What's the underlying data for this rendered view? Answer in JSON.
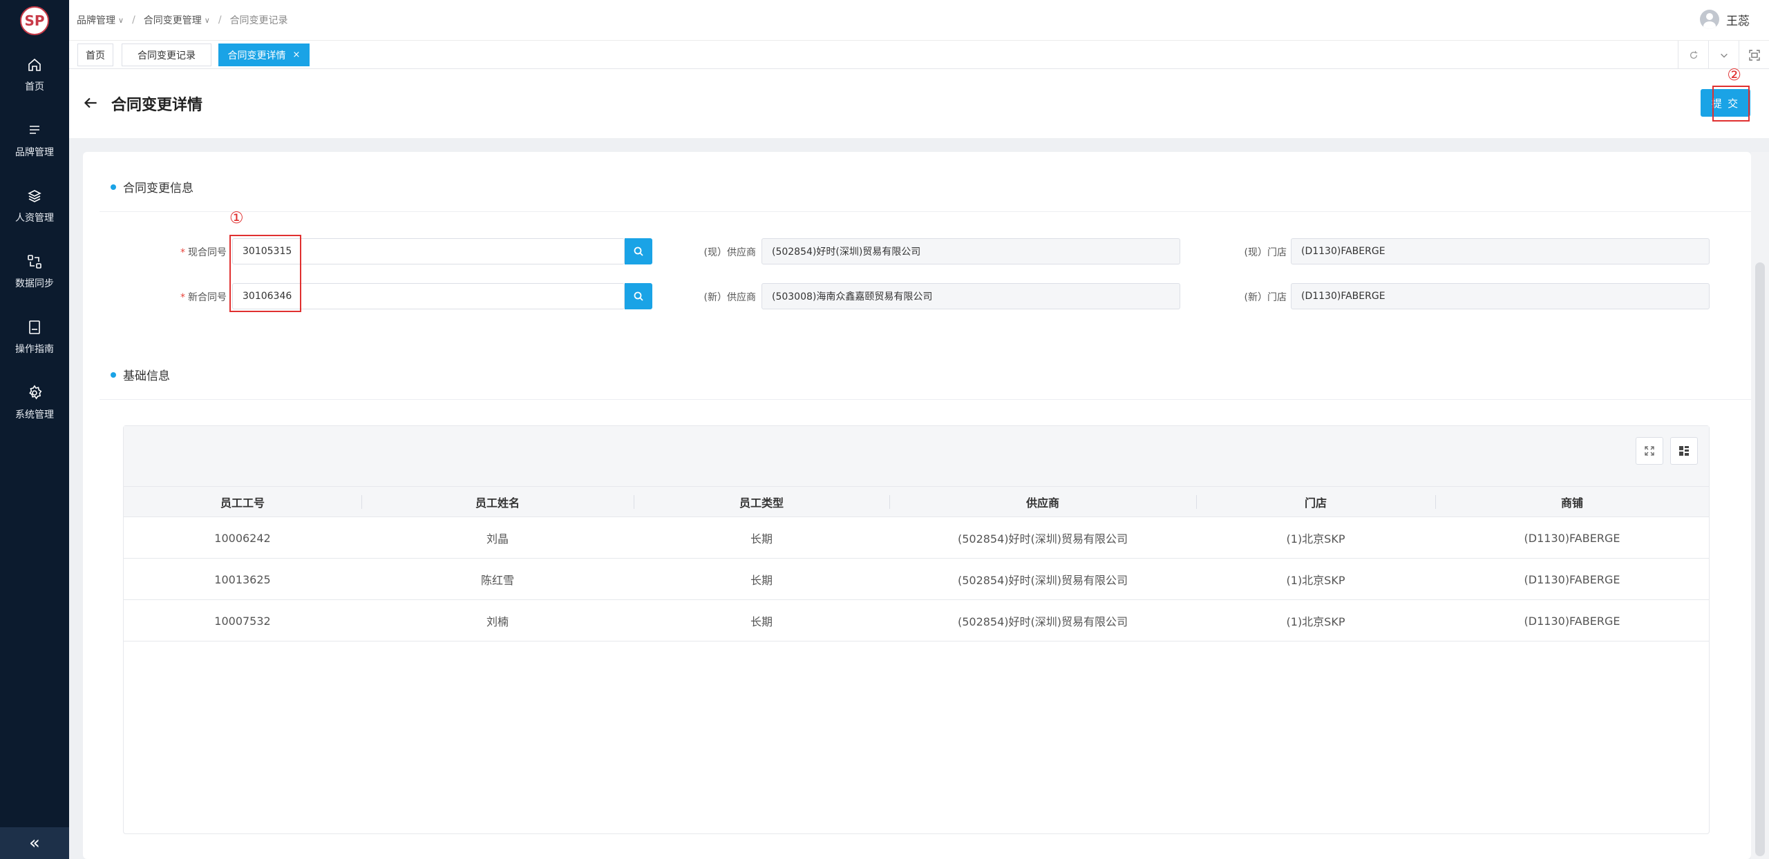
{
  "app": {
    "logo_text": "SP"
  },
  "sidebar": {
    "items": [
      {
        "label": "首页",
        "icon": "home-icon"
      },
      {
        "label": "品牌管理",
        "icon": "list-icon"
      },
      {
        "label": "人资管理",
        "icon": "layers-icon"
      },
      {
        "label": "数据同步",
        "icon": "sync-icon"
      },
      {
        "label": "操作指南",
        "icon": "book-icon"
      },
      {
        "label": "系统管理",
        "icon": "gear-icon"
      }
    ],
    "collapse_label": "«"
  },
  "breadcrumb": [
    {
      "label": "品牌管理",
      "has_dropdown": true
    },
    {
      "label": "合同变更管理",
      "has_dropdown": true
    },
    {
      "label": "合同变更记录",
      "has_dropdown": false
    }
  ],
  "user": {
    "name": "王蕊"
  },
  "tabs": [
    {
      "label": "首页",
      "active": false
    },
    {
      "label": "合同变更记录",
      "active": false
    },
    {
      "label": "合同变更详情",
      "active": true,
      "close": "×"
    }
  ],
  "page": {
    "title": "合同变更详情",
    "submit_label": "提 交",
    "annotation_1": "①",
    "annotation_2": "②"
  },
  "section_change": {
    "title": "合同变更信息",
    "current_contract_label": "现合同号",
    "current_contract_value": "30105315",
    "new_contract_label": "新合同号",
    "new_contract_value": "30106346",
    "current_supplier_label": "(现）供应商",
    "current_supplier_value": "(502854)好时(深圳)贸易有限公司",
    "new_supplier_label": "(新）供应商",
    "new_supplier_value": "(503008)海南众鑫嘉颐贸易有限公司",
    "current_store_label": "(现）门店",
    "current_store_value": "(D1130)FABERGE",
    "new_store_label": "(新）门店",
    "new_store_value": "(D1130)FABERGE"
  },
  "section_basic": {
    "title": "基础信息"
  },
  "table": {
    "columns": [
      "员工工号",
      "员工姓名",
      "员工类型",
      "供应商",
      "门店",
      "商铺"
    ],
    "rows": [
      [
        "10006242",
        "刘晶",
        "长期",
        "(502854)好时(深圳)贸易有限公司",
        "(1)北京SKP",
        "(D1130)FABERGE"
      ],
      [
        "10013625",
        "陈红雪",
        "长期",
        "(502854)好时(深圳)贸易有限公司",
        "(1)北京SKP",
        "(D1130)FABERGE"
      ],
      [
        "10007532",
        "刘楠",
        "长期",
        "(502854)好时(深圳)贸易有限公司",
        "(1)北京SKP",
        "(D1130)FABERGE"
      ]
    ]
  },
  "colors": {
    "sidebar_bg": "#0c1b2e",
    "accent": "#1aa3e6",
    "annotation": "#e03030"
  }
}
